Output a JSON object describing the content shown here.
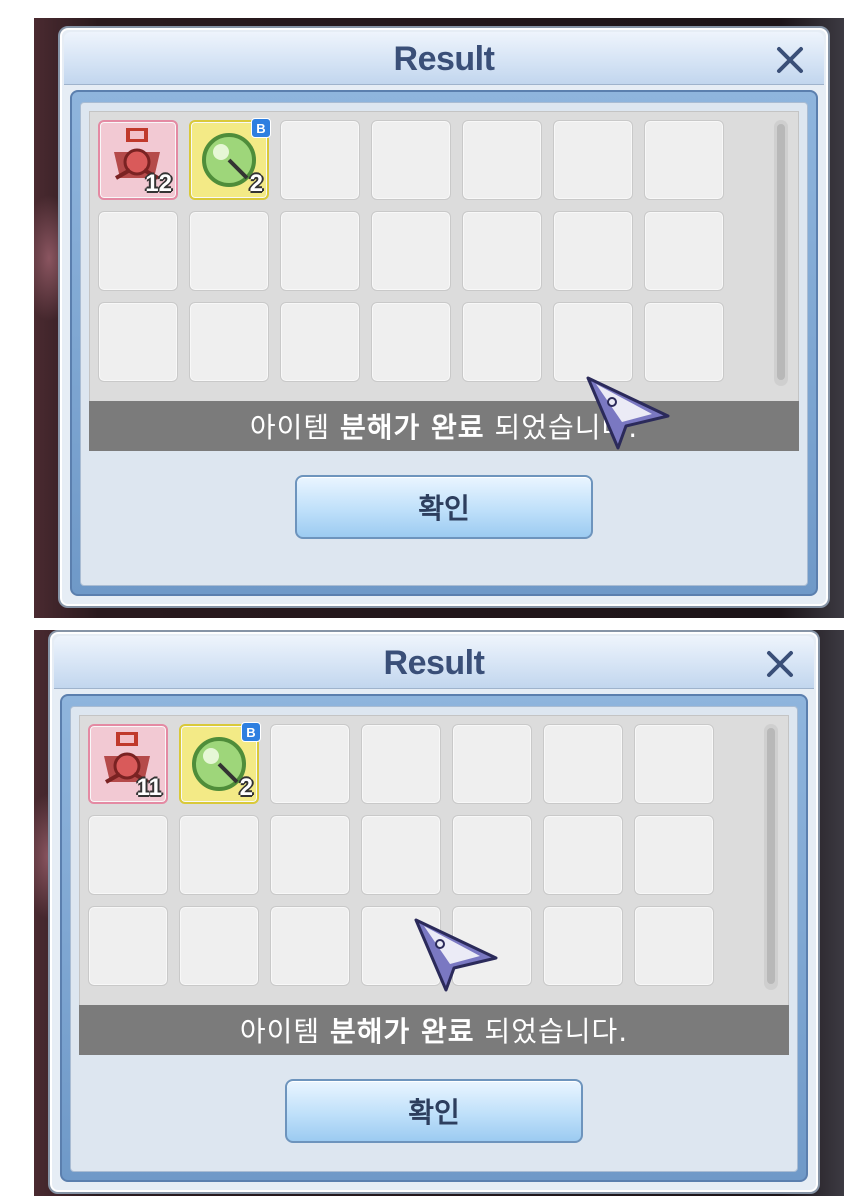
{
  "screenshots": [
    {
      "title": "Result",
      "items": [
        {
          "icon": "medal-icon",
          "quantity": "12",
          "badge": ""
        },
        {
          "icon": "green-orb-icon",
          "quantity": "2",
          "badge": "B"
        }
      ],
      "message_prefix": "아이템 ",
      "message_bold": "분해가 완료",
      "message_suffix": " 되었습니다.",
      "confirm_label": "확인"
    },
    {
      "title": "Result",
      "items": [
        {
          "icon": "medal-icon",
          "quantity": "11",
          "badge": ""
        },
        {
          "icon": "green-orb-icon",
          "quantity": "2",
          "badge": "B"
        }
      ],
      "message_prefix": "아이템 ",
      "message_bold": "분해가 완료",
      "message_suffix": " 되었습니다.",
      "confirm_label": "확인"
    }
  ],
  "colors": {
    "title_text": "#3a4f78",
    "item_pink": "#f2c9d3",
    "item_yellow": "#f3ea86",
    "message_bar": "#7b7b7b"
  }
}
